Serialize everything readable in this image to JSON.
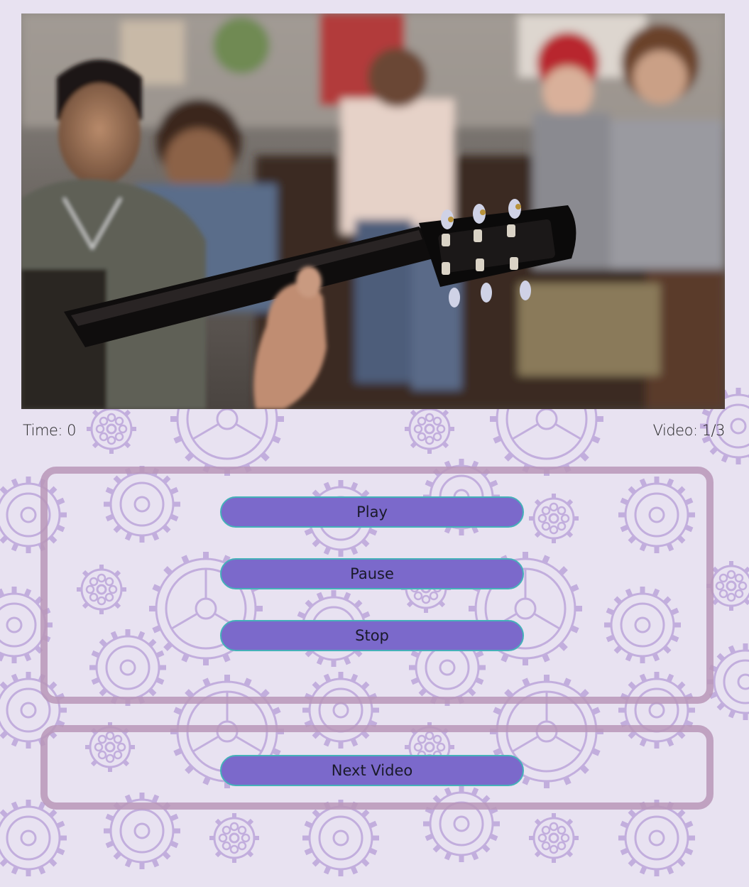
{
  "player": {
    "time_label": "Time: 0",
    "video_counter": "Video: 1/3"
  },
  "controls": {
    "play_label": "Play",
    "pause_label": "Pause",
    "stop_label": "Stop",
    "next_label": "Next Video"
  },
  "colors": {
    "background": "#e8e2f1",
    "gear_pattern": "#c2aedd",
    "panel_border": "#b996b9",
    "button_fill": "#7b69cb",
    "button_border": "#45b1b9"
  },
  "video": {
    "scene": "people on a couch watching a guitar headstock"
  }
}
